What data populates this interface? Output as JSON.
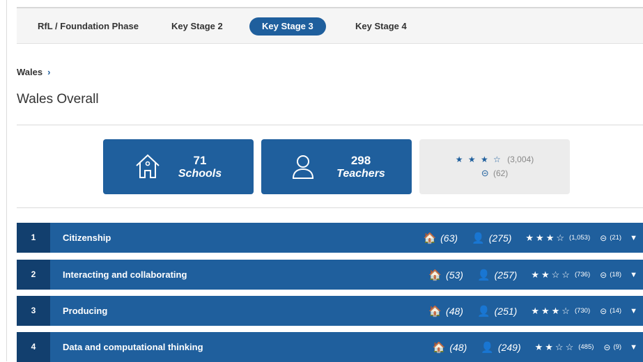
{
  "tabs": [
    {
      "label": "RfL / Foundation Phase",
      "active": false
    },
    {
      "label": "Key Stage 2",
      "active": false
    },
    {
      "label": "Key Stage 3",
      "active": true
    },
    {
      "label": "Key Stage 4",
      "active": false
    }
  ],
  "breadcrumb": {
    "label": "Wales",
    "chevron": "›"
  },
  "page_title": "Wales Overall",
  "summary": {
    "schools": {
      "count": "71",
      "label": "Schools",
      "icon": "house-outline-icon"
    },
    "teachers": {
      "count": "298",
      "label": "Teachers",
      "icon": "person-outline-icon"
    },
    "rating": {
      "stars": "★ ★ ★ ☆",
      "count": "(3,004)",
      "neutral_icon": "⊝",
      "neutral_count": "(62)"
    }
  },
  "rows": [
    {
      "num": "1",
      "name": "Citizenship",
      "schools": "(63)",
      "teachers": "(275)",
      "stars": "★★★☆",
      "rating_count": "(1,053)",
      "neutral": "(21)"
    },
    {
      "num": "2",
      "name": "Interacting and collaborating",
      "schools": "(53)",
      "teachers": "(257)",
      "stars": "★★☆☆",
      "rating_count": "(736)",
      "neutral": "(18)"
    },
    {
      "num": "3",
      "name": "Producing",
      "schools": "(48)",
      "teachers": "(251)",
      "stars": "★★★☆",
      "rating_count": "(730)",
      "neutral": "(14)"
    },
    {
      "num": "4",
      "name": "Data and computational thinking",
      "schools": "(48)",
      "teachers": "(249)",
      "stars": "★★☆☆",
      "rating_count": "(485)",
      "neutral": "(9)"
    }
  ],
  "icons": {
    "house": "🏠",
    "person": "👤",
    "neutral": "⊝",
    "caret": "▼"
  },
  "colors": {
    "primary": "#1f5f9d",
    "number_cell": "#123f6e",
    "grey_card": "#ececec"
  }
}
